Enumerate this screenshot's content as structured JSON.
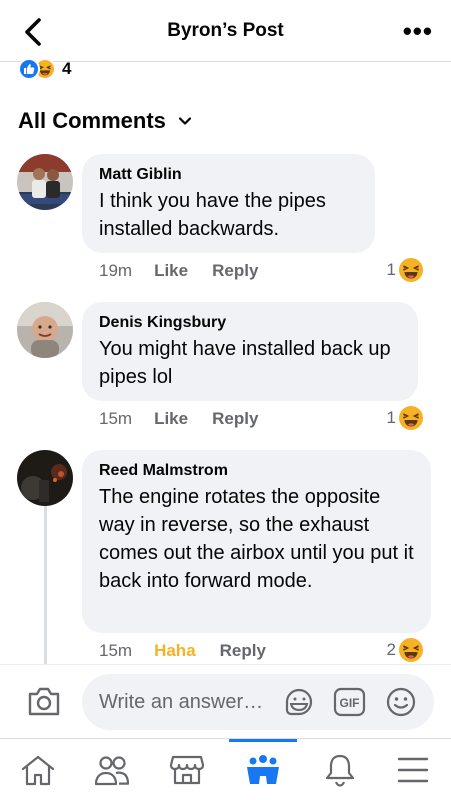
{
  "header": {
    "title": "Byron’s Post"
  },
  "reactions": {
    "count": "4"
  },
  "comments_section": {
    "label": "All Comments"
  },
  "comments": [
    {
      "author": "Matt Giblin",
      "text": "I think you have the pipes installed backwards.",
      "time": "19m",
      "like_label": "Like",
      "reply_label": "Reply",
      "reaction_count": "1"
    },
    {
      "author": "Denis Kingsbury",
      "text": "You might have installed back up pipes lol",
      "time": "15m",
      "like_label": "Like",
      "reply_label": "Reply",
      "reaction_count": "1"
    },
    {
      "author": "Reed Malmstrom",
      "text": "The engine rotates the opposite way in reverse, so the exhaust comes out the airbox until you put it back into forward mode.",
      "time": "15m",
      "like_label": "Haha",
      "reply_label": "Reply",
      "reaction_count": "2"
    }
  ],
  "composer": {
    "placeholder": "Write an answer…",
    "gif_label": "GIF"
  },
  "colors": {
    "accent": "#1877f2",
    "haha": "#f7b125",
    "bubble": "#f0f2f5",
    "meta": "#65676b"
  },
  "icons": [
    "back-icon",
    "more-icon",
    "like-reaction-icon",
    "haha-reaction-icon",
    "chevron-down-icon",
    "camera-icon",
    "sticker-icon",
    "gif-icon",
    "emoji-icon",
    "home-icon",
    "friends-icon",
    "marketplace-icon",
    "groups-icon",
    "bell-icon",
    "menu-icon"
  ]
}
